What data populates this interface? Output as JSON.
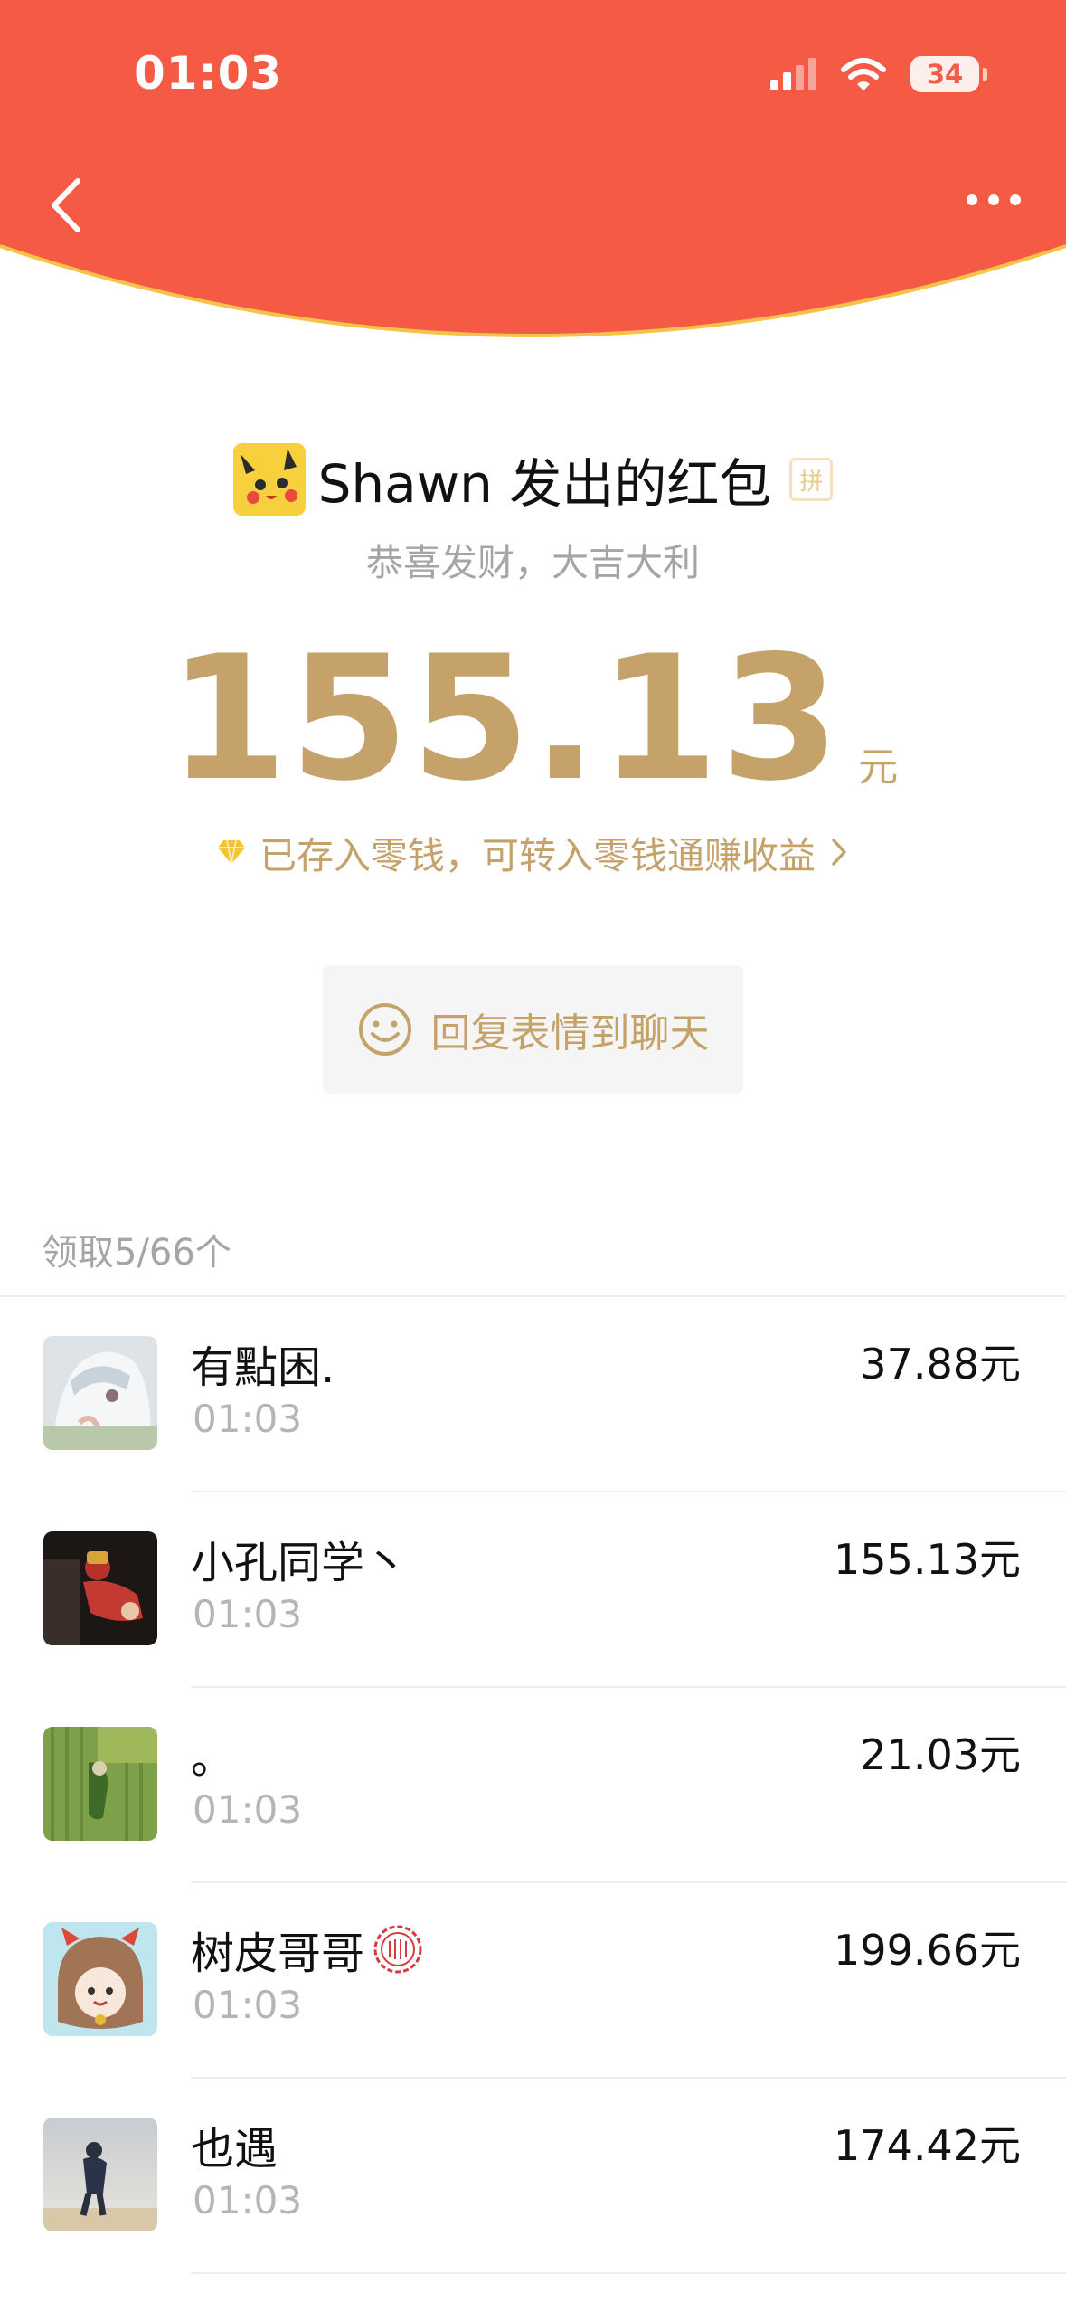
{
  "status_bar": {
    "time": "01:03",
    "battery": "34"
  },
  "header": {
    "back_icon": "chevron-left-icon",
    "more_icon": "more-dots-icon",
    "color": "#f45a44"
  },
  "packet": {
    "title": "Shawn 发出的红包",
    "badge": "拼",
    "greeting": "恭喜发财，大吉大利",
    "amount": "155.13",
    "unit": "元",
    "saved_text": "已存入零钱，可转入零钱通赚收益",
    "saved_icon": "diamond-icon",
    "reply_button": "回复表情到聊天",
    "reply_icon": "smiley-icon",
    "accent": "#c4a26a"
  },
  "list": {
    "count_label": "领取5/66个",
    "items": [
      {
        "name": "有點困.",
        "time": "01:03",
        "amount": "37.88元"
      },
      {
        "name": "小孔同学丶",
        "time": "01:03",
        "amount": "155.13元"
      },
      {
        "name": "。",
        "time": "01:03",
        "amount": "21.03元"
      },
      {
        "name": "树皮哥哥",
        "time": "01:03",
        "amount": "199.66元",
        "badge_icon": "seal-stamp-icon"
      },
      {
        "name": "也遇",
        "time": "01:03",
        "amount": "174.42元"
      }
    ]
  }
}
